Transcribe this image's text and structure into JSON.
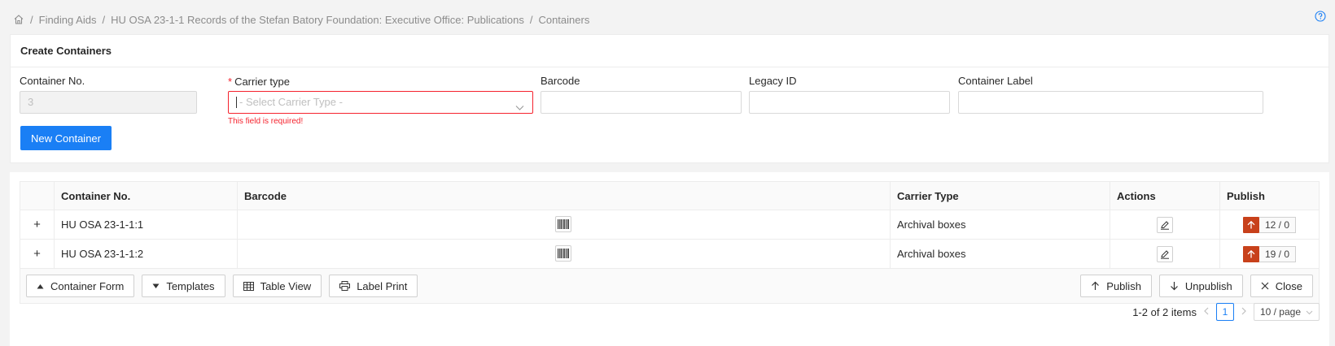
{
  "breadcrumb": {
    "items": [
      "Finding Aids",
      "HU OSA 23-1-1 Records of the Stefan Batory Foundation: Executive Office: Publications",
      "Containers"
    ],
    "separator": "/"
  },
  "form": {
    "title": "Create Containers",
    "container_no": {
      "label": "Container No.",
      "value": "3"
    },
    "carrier_type": {
      "label": "Carrier type",
      "required_mark": "*",
      "placeholder": "- Select Carrier Type -",
      "error": "This field is required!"
    },
    "barcode": {
      "label": "Barcode",
      "value": ""
    },
    "legacy_id": {
      "label": "Legacy ID",
      "value": ""
    },
    "container_label": {
      "label": "Container Label",
      "value": ""
    },
    "new_button": "New Container"
  },
  "table": {
    "columns": [
      "Container No.",
      "Barcode",
      "Carrier Type",
      "Actions",
      "Publish"
    ],
    "rows": [
      {
        "expand": "+",
        "container_no": "HU OSA 23-1-1:1",
        "carrier_type": "Archival boxes",
        "publish_count": "12 / 0"
      },
      {
        "expand": "+",
        "container_no": "HU OSA 23-1-1:2",
        "carrier_type": "Archival boxes",
        "publish_count": "19 / 0"
      }
    ]
  },
  "toolbar": {
    "container_form": "Container Form",
    "templates": "Templates",
    "table_view": "Table View",
    "label_print": "Label Print",
    "publish": "Publish",
    "unpublish": "Unpublish",
    "close": "Close"
  },
  "pagination": {
    "summary": "1-2 of 2 items",
    "current_page": "1",
    "page_size": "10 / page"
  },
  "colors": {
    "primary": "#1a7ff5",
    "error": "#f5222d",
    "publish_accent": "#c8411b"
  }
}
